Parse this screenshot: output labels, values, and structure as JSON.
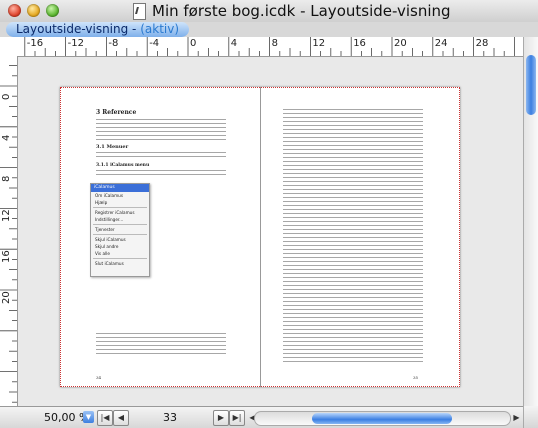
{
  "window": {
    "title": "Min første bog.icdk - Layoutside-visning"
  },
  "tab": {
    "label": "Layoutside-visning - ",
    "status": "(aktiv)"
  },
  "hruler_labels": [
    "-16",
    "-12",
    "-8",
    "-4",
    "0",
    "4",
    "8",
    "12",
    "16",
    "20",
    "24",
    "28"
  ],
  "vruler_labels": [
    "0",
    "4",
    "8",
    "12",
    "16",
    "20"
  ],
  "page_left": {
    "heading": "3   Reference",
    "subheading": "3.1   Menuer",
    "subsub": "3.1.1   iCalamus menu",
    "menu": {
      "header": "iCalamus",
      "items": [
        "Om iCalamus",
        "Hjælp",
        "Registrer iCalamus",
        "Indstillinger...",
        "Tjenester",
        "Skjul iCalamus",
        "Skjul andre",
        "Vis alle",
        "Slut iCalamus"
      ]
    },
    "page_number": "34"
  },
  "page_right": {
    "page_number": "35"
  },
  "bottom": {
    "zoom": "50,00 %",
    "page": "33"
  },
  "colors": {
    "accent": "#3b7fe2",
    "margin_guide": "#cc3333"
  }
}
